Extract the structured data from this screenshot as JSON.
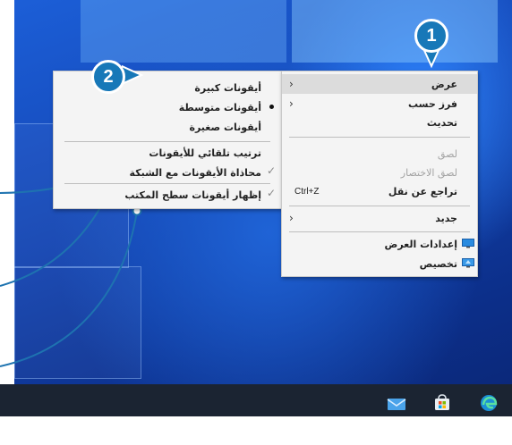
{
  "callouts": {
    "one": "1",
    "two": "2"
  },
  "main_menu": {
    "items": [
      {
        "label": "عرض",
        "submenu": true,
        "highlighted": true
      },
      {
        "label": "فرز حسب",
        "submenu": true
      },
      {
        "label": "تحديث"
      },
      {
        "label": "لصق",
        "disabled": true
      },
      {
        "label": "لصق الاختصار",
        "disabled": true
      },
      {
        "label": "تراجع عن نقل",
        "shortcut": "Ctrl+Z"
      },
      {
        "label": "جديد",
        "submenu": true
      },
      {
        "label": "إعدادات العرض",
        "icon": "display-settings-icon"
      },
      {
        "label": "تخصيص",
        "icon": "personalize-icon"
      }
    ]
  },
  "view_submenu": {
    "items": [
      {
        "label": "أيقونات كبيرة"
      },
      {
        "label": "أيقونات متوسطة",
        "selected": true
      },
      {
        "label": "أيقونات صغيرة"
      },
      {
        "label": "ترتيب تلقائي للأيقونات"
      },
      {
        "label": "محاذاة الأيقونات مع الشبكة",
        "checked": true
      },
      {
        "label": "إظهار أيقونات سطح المكتب",
        "checked": true
      }
    ]
  },
  "taskbar": {
    "icons": [
      "mail-icon",
      "store-icon",
      "edge-icon"
    ]
  },
  "colors": {
    "callout": "#1778b8",
    "leader_line": "#1e73b0",
    "menu_bg": "#f4f4f4",
    "taskbar": "#1b2432"
  }
}
